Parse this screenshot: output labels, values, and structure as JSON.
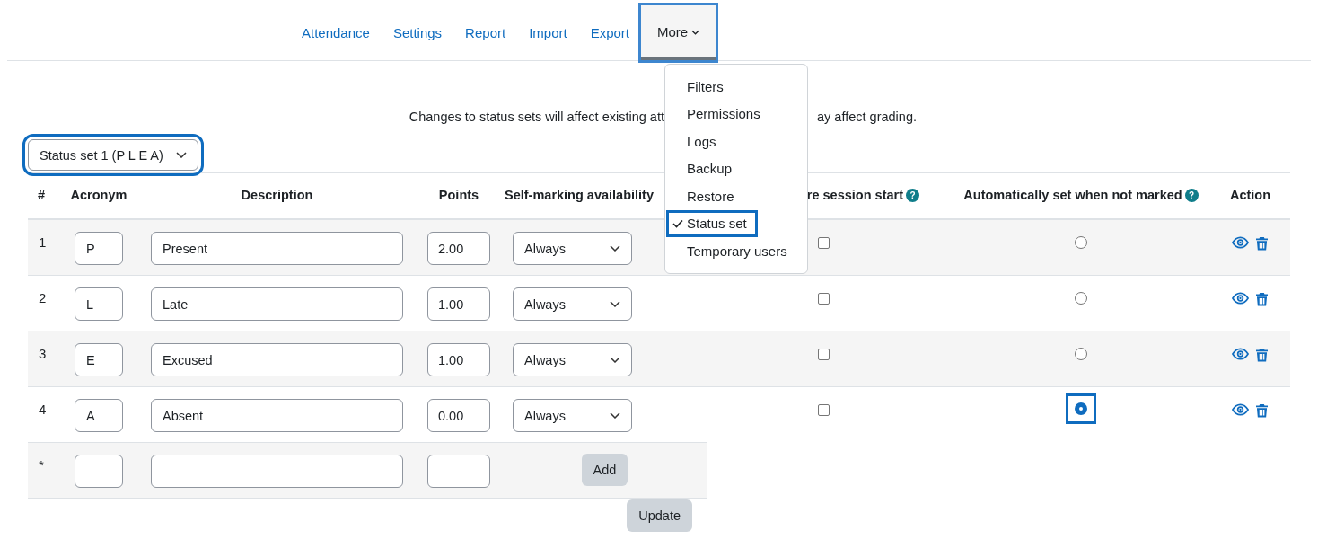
{
  "nav": [
    {
      "label": "Attendance",
      "selected": false,
      "focused": false,
      "kind": "link"
    },
    {
      "label": "Settings",
      "selected": false,
      "focused": false,
      "kind": "link"
    },
    {
      "label": "Report",
      "selected": false,
      "focused": false,
      "kind": "link"
    },
    {
      "label": "Import",
      "selected": false,
      "focused": false,
      "kind": "link"
    },
    {
      "label": "Export",
      "selected": false,
      "focused": false,
      "kind": "link"
    },
    {
      "label": "More",
      "selected": true,
      "focused": true,
      "kind": "dropdown"
    }
  ],
  "menu": {
    "items": [
      {
        "label": "Filters",
        "selected": false,
        "focused": false
      },
      {
        "label": "Permissions",
        "selected": false,
        "focused": false
      },
      {
        "label": "Logs",
        "selected": false,
        "focused": false
      },
      {
        "label": "Backup",
        "selected": false,
        "focused": false
      },
      {
        "label": "Restore",
        "selected": false,
        "focused": false
      },
      {
        "label": "Status set",
        "selected": true,
        "focused": true
      },
      {
        "label": "Temporary users",
        "selected": false,
        "focused": false
      }
    ]
  },
  "notice": {
    "left": "Changes to status sets will affect existing att",
    "right": "ay affect grading."
  },
  "status_select": {
    "value": "Status set 1 (P L E A)",
    "focused": true
  },
  "table": {
    "columns": [
      {
        "label": "#"
      },
      {
        "label": "Acronym"
      },
      {
        "label": "Description"
      },
      {
        "label": "Points"
      },
      {
        "label": "Self-marking availability"
      },
      {
        "label": "re session start",
        "help": "?"
      },
      {
        "label": "Automatically set when not marked",
        "help": "?"
      },
      {
        "label": "Action"
      }
    ],
    "rows": [
      {
        "number": "1",
        "acronym": "P",
        "description": "Present",
        "points": "2.00",
        "availability": "Always",
        "checked": false,
        "auto_set": false,
        "focused": false
      },
      {
        "number": "2",
        "acronym": "L",
        "description": "Late",
        "points": "1.00",
        "availability": "Always",
        "checked": false,
        "auto_set": false,
        "focused": false
      },
      {
        "number": "3",
        "acronym": "E",
        "description": "Excused",
        "points": "1.00",
        "availability": "Always",
        "checked": false,
        "auto_set": false,
        "focused": false
      },
      {
        "number": "4",
        "acronym": "A",
        "description": "Absent",
        "points": "0.00",
        "availability": "Always",
        "checked": false,
        "auto_set": true,
        "focused": true
      }
    ],
    "new_row": {
      "marker": "*",
      "add_button": "Add"
    }
  },
  "update_button": "Update"
}
